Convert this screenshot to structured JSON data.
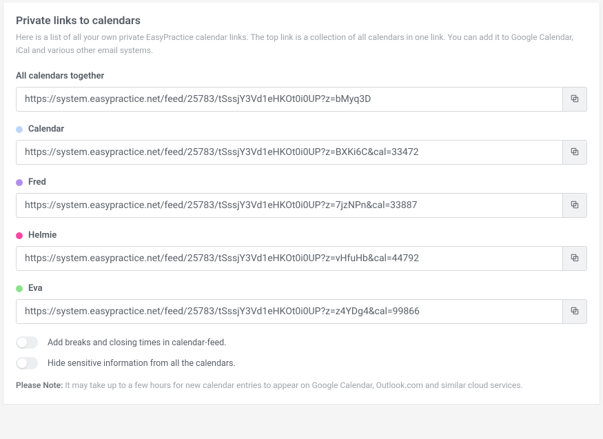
{
  "title": "Private links to calendars",
  "description": "Here is a list of all your own private EasyPractice calendar links. The top link is a collection of all calendars in one link. You can add it to Google Calendar, iCal and various other email systems.",
  "all_label": "All calendars together",
  "all_url": "https://system.easypractice.net/feed/25783/tSssjY3Vd1eHKOt0i0UP?z=bMyq3D",
  "calendars": [
    {
      "name": "Calendar",
      "color": "#bcd6f7",
      "url": "https://system.easypractice.net/feed/25783/tSssjY3Vd1eHKOt0i0UP?z=BXKi6C&cal=33472"
    },
    {
      "name": "Fred",
      "color": "#b08ee8",
      "url": "https://system.easypractice.net/feed/25783/tSssjY3Vd1eHKOt0i0UP?z=7jzNPn&cal=33887"
    },
    {
      "name": "Helmie",
      "color": "#f54aa0",
      "url": "https://system.easypractice.net/feed/25783/tSssjY3Vd1eHKOt0i0UP?z=vHfuHb&cal=44792"
    },
    {
      "name": "Eva",
      "color": "#8ce28c",
      "url": "https://system.easypractice.net/feed/25783/tSssjY3Vd1eHKOt0i0UP?z=z4YDg4&cal=99866"
    }
  ],
  "toggles": [
    {
      "label": "Add breaks and closing times in calendar-feed."
    },
    {
      "label": "Hide sensitive information from all the calendars."
    }
  ],
  "note_lead": "Please Note:",
  "note_body": "It may take up to a few hours for new calendar entries to appear on Google Calendar, Outlook.com and similar cloud services."
}
